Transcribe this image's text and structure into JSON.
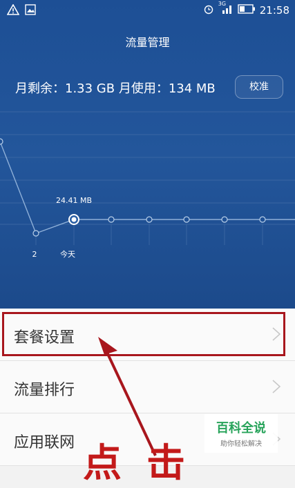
{
  "status_bar": {
    "time": "21:58",
    "network": "3G"
  },
  "header": {
    "title": "流量管理"
  },
  "usage": {
    "summary": "月剩余：1.33 GB 月使用：134 MB",
    "calibrate_label": "校准"
  },
  "chart_data": {
    "type": "line",
    "point_label": "24.41 MB",
    "x_labels": [
      "2",
      "今天"
    ],
    "colors": {
      "line": "#8fb0d8",
      "grid": "#4f76ad"
    }
  },
  "list": {
    "items": [
      {
        "label": "套餐设置"
      },
      {
        "label": "流量排行"
      },
      {
        "label": "应用联网"
      }
    ]
  },
  "watermark": {
    "main": "百科全说",
    "sub": "助你轻松解决"
  },
  "overlay": {
    "text": "点击"
  }
}
